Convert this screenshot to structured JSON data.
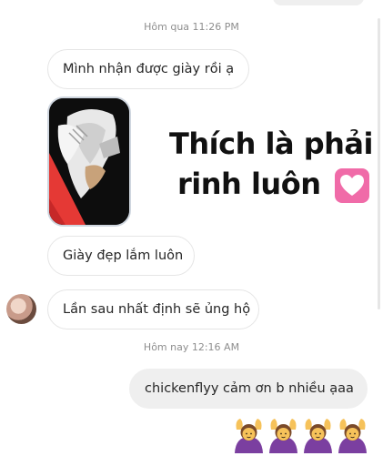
{
  "thread": {
    "timestamp_1": "Hôm qua 11:26 PM",
    "timestamp_2": "Hôm nay 12:16 AM"
  },
  "messages": {
    "msg_1": "Mình nhận được giày rồi ạ",
    "msg_2": "Giày đẹp lắm luôn",
    "msg_3": "Lần sau nhất định sẽ ủng hộ",
    "reply": "chickenflyy cảm ơn b nhiều ạaa"
  },
  "overlay": {
    "line_1": "Thích là phải",
    "line_2": "rinh luôn"
  },
  "icons": {
    "heart": "pink-heart-emoji",
    "reaction": "woman-gesturing-ok-emoji"
  },
  "colors": {
    "bubble_incoming_border": "#e5e5e5",
    "bubble_outgoing_bg": "#efefef",
    "timestamp_text": "#8e8e8e",
    "heart_pink": "#f06ba8"
  }
}
